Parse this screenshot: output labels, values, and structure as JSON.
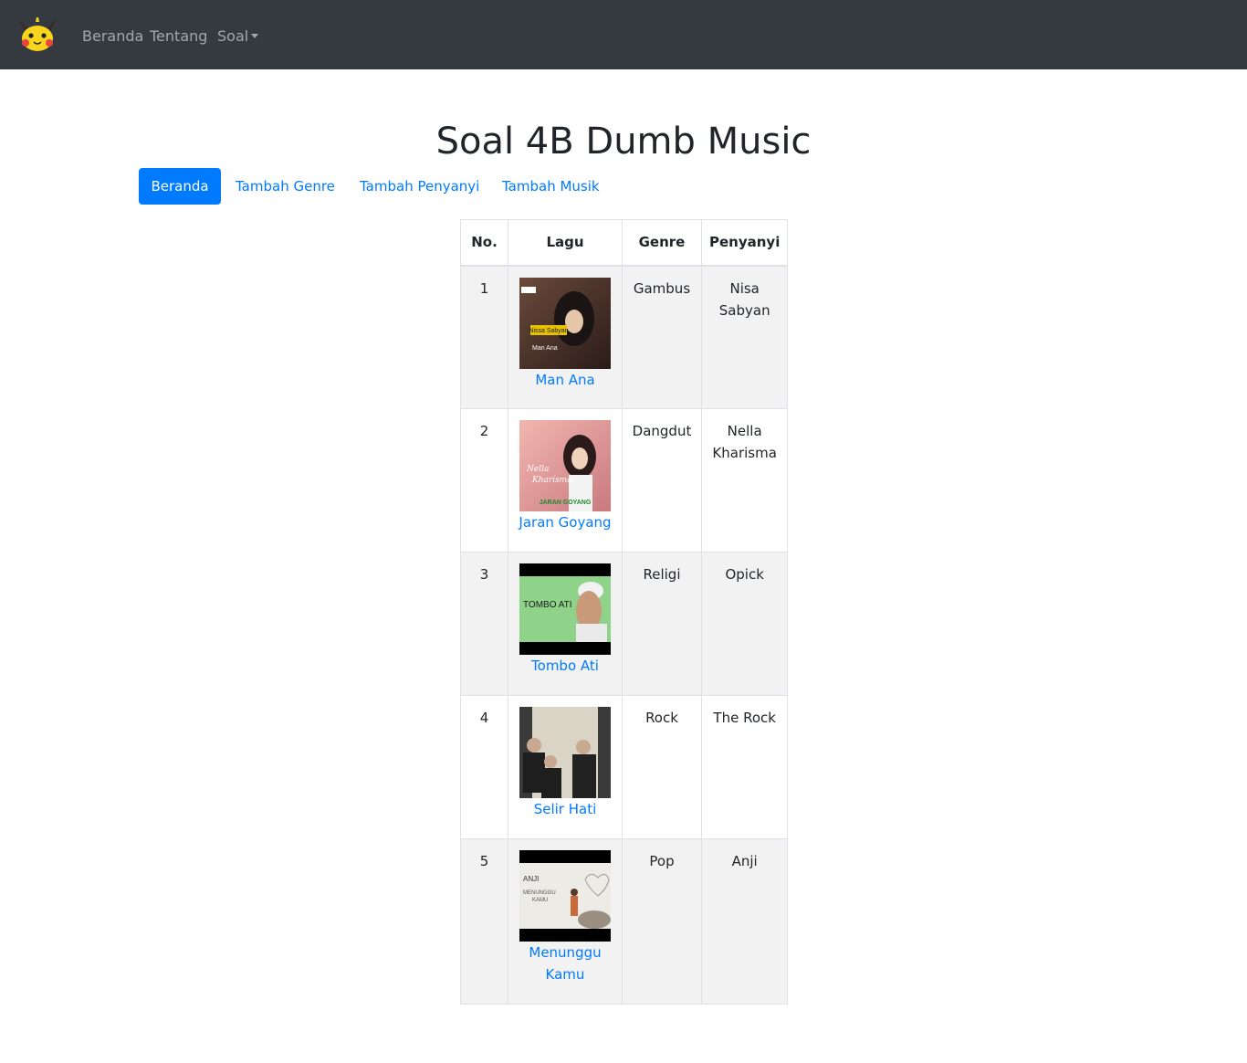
{
  "navbar": {
    "items": [
      {
        "label": "Beranda"
      },
      {
        "label": "Tentang"
      },
      {
        "label": "Soal"
      }
    ]
  },
  "title": "Soal 4B Dumb Music",
  "tabs": [
    {
      "label": "Beranda",
      "active": true
    },
    {
      "label": "Tambah Genre",
      "active": false
    },
    {
      "label": "Tambah Penyanyi",
      "active": false
    },
    {
      "label": "Tambah Musik",
      "active": false
    }
  ],
  "table": {
    "headers": [
      "No.",
      "Lagu",
      "Genre",
      "Penyanyi"
    ],
    "rows": [
      {
        "no": "1",
        "song": "Man Ana",
        "genre": "Gambus",
        "singer": "Nisa Sabyan",
        "thumb_text": [
          "Nissa Sabyan",
          "Man Ana"
        ]
      },
      {
        "no": "2",
        "song": "Jaran Goyang",
        "genre": "Dangdut",
        "singer": "Nella Kharisma",
        "thumb_text": [
          "Nella",
          "Kharisma",
          "JARAN GOYANG"
        ]
      },
      {
        "no": "3",
        "song": "Tombo Ati",
        "genre": "Religi",
        "singer": "Opick",
        "thumb_text": [
          "TOMBO ATI"
        ]
      },
      {
        "no": "4",
        "song": "Selir Hati",
        "genre": "Rock",
        "singer": "The Rock",
        "thumb_text": []
      },
      {
        "no": "5",
        "song": "Menunggu Kamu",
        "genre": "Pop",
        "singer": "Anji",
        "thumb_text": [
          "ANJI",
          "MENUNGGU",
          "KAMU"
        ]
      }
    ]
  },
  "colors": {
    "navbar_bg": "#343a40",
    "primary": "#007bff",
    "stripe": "#f2f2f2"
  }
}
